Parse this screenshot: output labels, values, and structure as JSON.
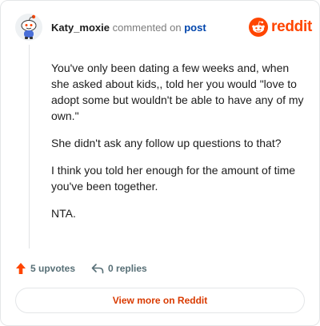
{
  "comment": {
    "username": "Katy_moxie",
    "verb": "commented on",
    "post_link": "post",
    "paragraphs": [
      "You've only been dating a few weeks and, when she asked about kids,, told her you would \"love to adopt some but wouldn't be able to have any of my own.\"",
      "She didn't ask any follow up questions to that?",
      "I think you told her enough for the amount of time you've been together.",
      "NTA."
    ],
    "upvotes": "5 upvotes",
    "replies": "0 replies"
  },
  "logo": {
    "text": "reddit",
    "icon": "reddit-snoo-icon"
  },
  "footer": {
    "view_more": "View more on Reddit"
  },
  "colors": {
    "brand": "#ff4500",
    "link": "#0045ac",
    "view_more": "#d93a00",
    "muted": "#576f76"
  }
}
